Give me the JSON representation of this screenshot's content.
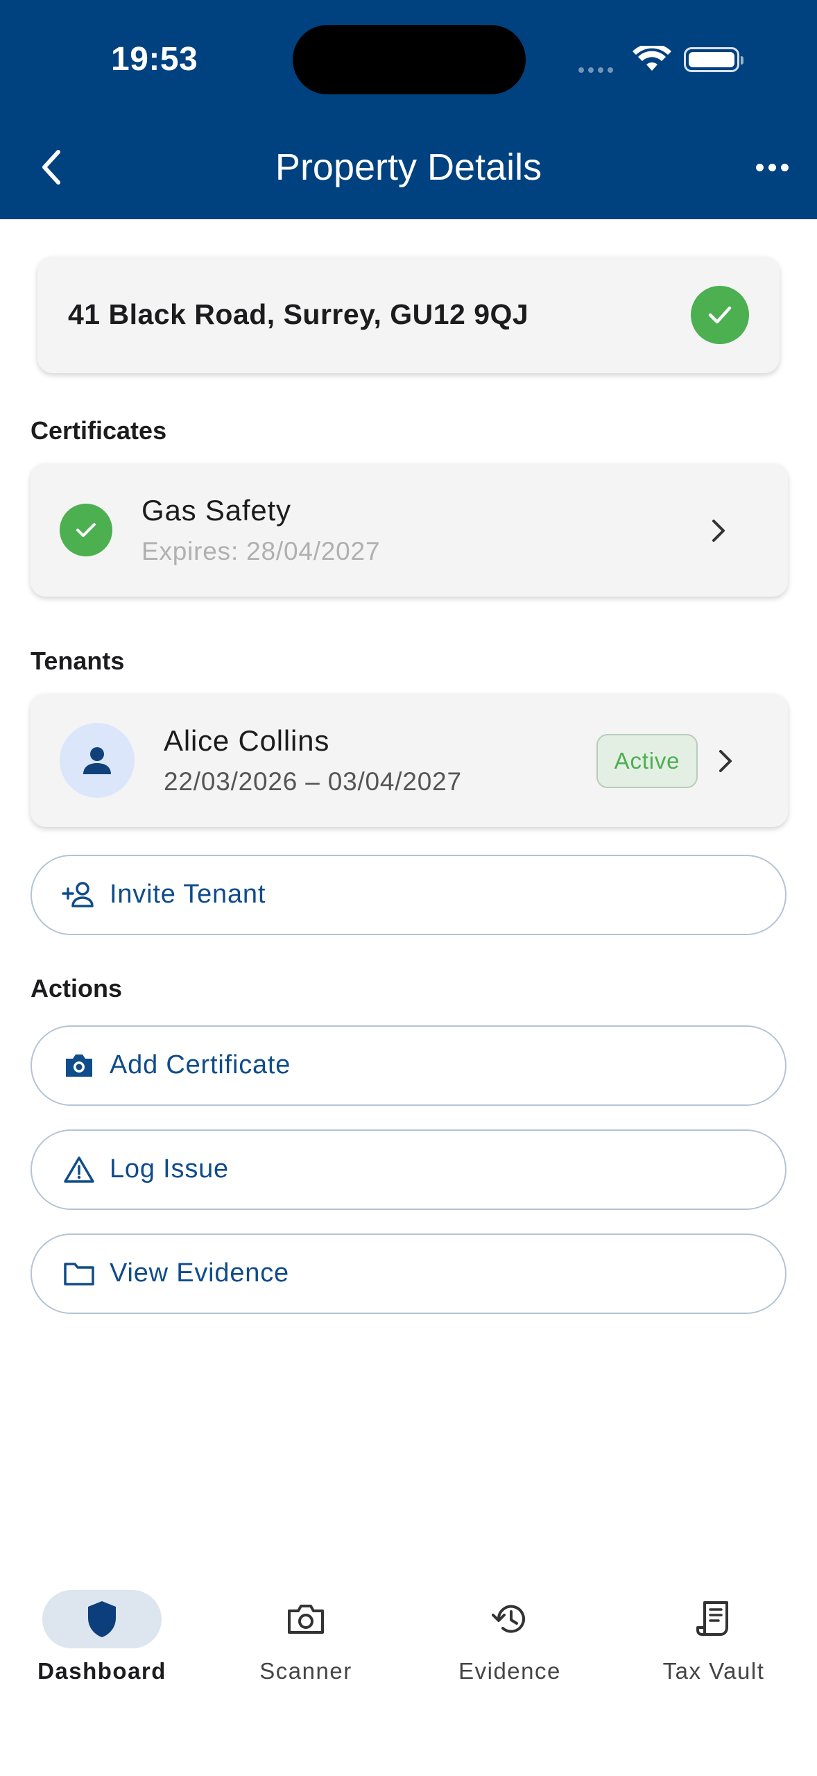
{
  "status_bar": {
    "time": "19:53"
  },
  "header": {
    "title": "Property Details"
  },
  "property": {
    "address": "41 Black Road, Surrey, GU12 9QJ"
  },
  "sections": {
    "certificates": "Certificates",
    "tenants": "Tenants",
    "actions": "Actions"
  },
  "certificate": {
    "name": "Gas Safety",
    "expiry": "Expires: 28/04/2027"
  },
  "tenant": {
    "name": "Alice Collins",
    "dates": "22/03/2026 – 03/04/2027",
    "status": "Active"
  },
  "buttons": {
    "invite_tenant": "Invite Tenant",
    "add_certificate": "Add Certificate",
    "log_issue": "Log Issue",
    "view_evidence": "View Evidence"
  },
  "nav": {
    "dashboard": "Dashboard",
    "scanner": "Scanner",
    "evidence": "Evidence",
    "tax_vault": "Tax Vault"
  },
  "colors": {
    "header_bg": "#00417f",
    "success": "#4caf50",
    "link": "#0f4c8a",
    "nav_active_bg": "#dde5ee"
  }
}
